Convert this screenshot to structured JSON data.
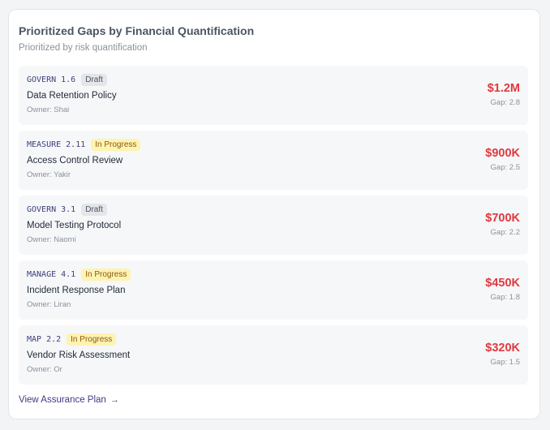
{
  "card": {
    "title": "Prioritized Gaps by Financial Quantification",
    "subtitle": "Prioritized by risk quantification"
  },
  "gaps": [
    {
      "code": "GOVERN 1.6",
      "status": "Draft",
      "status_type": "draft",
      "title": "Data Retention Policy",
      "owner": "Owner: Shai",
      "amount": "$1.2M",
      "gap": "Gap: 2.8"
    },
    {
      "code": "MEASURE 2.11",
      "status": "In Progress",
      "status_type": "progress",
      "title": "Access Control Review",
      "owner": "Owner: Yakir",
      "amount": "$900K",
      "gap": "Gap: 2.5"
    },
    {
      "code": "GOVERN 3.1",
      "status": "Draft",
      "status_type": "draft",
      "title": "Model Testing Protocol",
      "owner": "Owner: Naomi",
      "amount": "$700K",
      "gap": "Gap: 2.2"
    },
    {
      "code": "MANAGE 4.1",
      "status": "In Progress",
      "status_type": "progress",
      "title": "Incident Response Plan",
      "owner": "Owner: Liran",
      "amount": "$450K",
      "gap": "Gap: 1.8"
    },
    {
      "code": "MAP 2.2",
      "status": "In Progress",
      "status_type": "progress",
      "title": "Vendor Risk Assessment",
      "owner": "Owner: Or",
      "amount": "$320K",
      "gap": "Gap: 1.5"
    }
  ],
  "footer": {
    "link_label": "View Assurance Plan",
    "arrow_icon": "arrow-right-icon"
  },
  "colors": {
    "amount": "#e0393e",
    "link": "#3d3b85",
    "code": "#3e3f7a",
    "draft_badge": "#e4e6ea",
    "progress_badge": "#fef3b2"
  }
}
